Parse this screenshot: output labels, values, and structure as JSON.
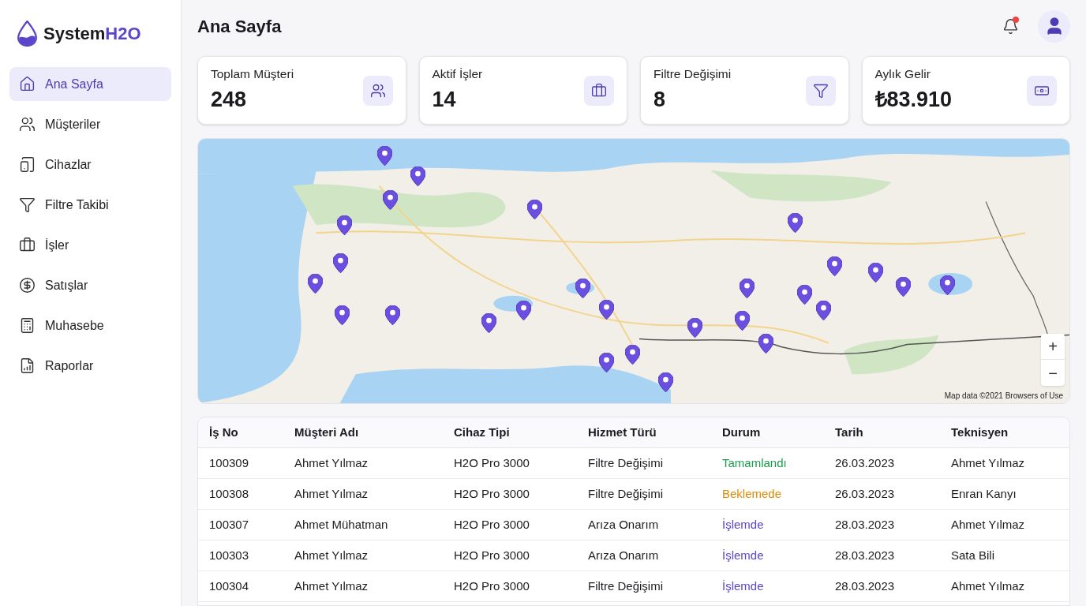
{
  "brand": {
    "name": "System",
    "accent": "H2O"
  },
  "nav": [
    {
      "label": "Ana Sayfa",
      "selected": true
    },
    {
      "label": "Müşteriler",
      "selected": false
    },
    {
      "label": "Cihazlar",
      "selected": false
    },
    {
      "label": "Filtre Takibi",
      "selected": false
    },
    {
      "label": "İşler",
      "selected": false
    },
    {
      "label": "Satışlar",
      "selected": false
    },
    {
      "label": "Muhasebe",
      "selected": false
    },
    {
      "label": "Raporlar",
      "selected": false
    }
  ],
  "page_title": "Ana Sayfa",
  "notifications": {
    "unread": true
  },
  "stats": [
    {
      "label": "Toplam Müşteri",
      "value": "248"
    },
    {
      "label": "Aktif İşler",
      "value": "14"
    },
    {
      "label": "Filtre Değişimi",
      "value": "8"
    },
    {
      "label": "Aylık Gelir",
      "value": "₺83.910"
    }
  ],
  "map": {
    "zoom_in": "+",
    "zoom_out": "−",
    "attribution": "Map data ©2021 Browsers of Use"
  },
  "table": {
    "columns": [
      "İş No",
      "Müşteri Adı",
      "Cihaz Tipi",
      "Hizmet Türü",
      "Durum",
      "Tarih",
      "Teknisyen"
    ],
    "rows": [
      {
        "cells": [
          "100309",
          "Ahmet Yılmaz",
          "H2O Pro 3000",
          "Filtre Değişimi"
        ],
        "status": {
          "text": "Tamamlandı",
          "color": "#1a9a4a"
        },
        "date": "26.03.2023",
        "technician": "Ahmet Yılmaz"
      },
      {
        "cells": [
          "100308",
          "Ahmet Yılmaz",
          "H2O Pro 3000",
          "Filtre Değişimi"
        ],
        "status": {
          "text": "Beklemede",
          "color": "#e08a00"
        },
        "date": "26.03.2023",
        "technician": "Enran Kanyı"
      },
      {
        "cells": [
          "100307",
          "Ahmet Mühatman",
          "H2O Pro 3000",
          "Arıza Onarım"
        ],
        "status": {
          "text": "İşlemde",
          "color": "#5b45c9"
        },
        "date": "28.03.2023",
        "technician": "Ahmet Yılmaz"
      },
      {
        "cells": [
          "100303",
          "Ahmet Yılmaz",
          "H2O Pro 3000",
          "Arıza Onarım"
        ],
        "status": {
          "text": "İşlemde",
          "color": "#5b45c9"
        },
        "date": "28.03.2023",
        "technician": "Sata Bili"
      },
      {
        "cells": [
          "100304",
          "Ahmet Yılmaz",
          "H2O Pro 3000",
          "Filtre Değişimi"
        ],
        "status": {
          "text": "İşlemde",
          "color": "#5b45c9"
        },
        "date": "28.03.2023",
        "technician": "Ahmet Yılmaz"
      }
    ]
  }
}
